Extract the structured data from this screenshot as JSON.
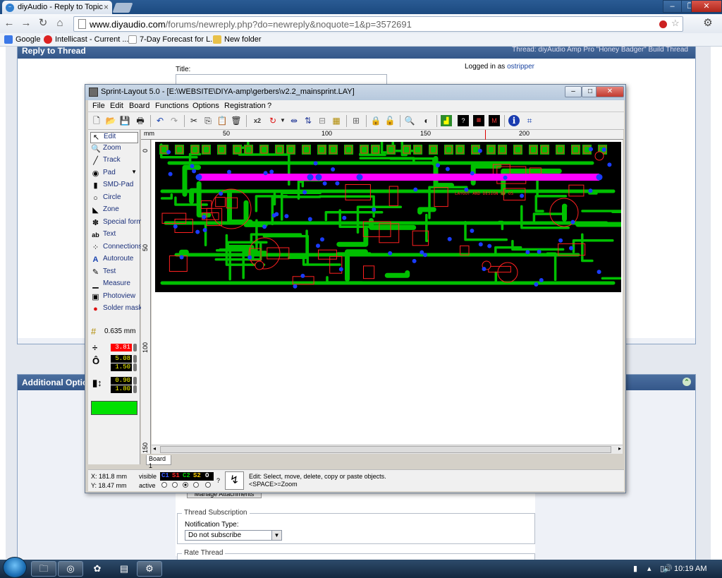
{
  "browser": {
    "tab_title": "diyAudio - Reply to Topic",
    "url_host": "www.diyaudio.com",
    "url_path": "/forums/newreply.php?do=newreply&noquote=1&p=3572691",
    "bookmarks": [
      "Google",
      "Intellicast - Current ...",
      "7-Day Forecast for L...",
      "New folder"
    ]
  },
  "forum": {
    "reply_header": "Reply to Thread",
    "thread_ref": "Thread: diyAudio Amp Pro \"Honey Badger\" Build Thread",
    "title_label": "Title:",
    "logged_in_label": "Logged in as",
    "username": "ostripper",
    "additional_options_header": "Additional Options",
    "manage_attachments_label": "Manage Attachments",
    "thread_subscription_legend": "Thread Subscription",
    "notification_type_label": "Notification Type:",
    "notification_value": "Do not subscribe",
    "rate_thread_legend": "Rate Thread"
  },
  "sprint": {
    "window_title": "Sprint-Layout 5.0 - [E:\\WEBSITE\\DIYA-amp\\gerbers\\v2.2_mainsprint.LAY]",
    "menu": [
      "File",
      "Edit",
      "Board",
      "Functions",
      "Options",
      "Registration",
      "?"
    ],
    "toolbar_x2": "x2",
    "tools": [
      "Edit",
      "Zoom",
      "Track",
      "Pad",
      "SMD-Pad",
      "Circle",
      "Zone",
      "Special form",
      "Text",
      "Connections",
      "Autoroute",
      "Test",
      "Measure",
      "Photoview",
      "Solder mask"
    ],
    "grid_value": "0.635 mm",
    "track_width": "3.81",
    "pad_outer": "5.08",
    "pad_inner": "1.50",
    "smd_w": "0.90",
    "smd_h": "1.80",
    "ruler_unit": "mm",
    "ruler_top": [
      "50",
      "100",
      "150",
      "200"
    ],
    "ruler_left": [
      "0",
      "50",
      "100",
      "150"
    ],
    "board_tab": "Board 1",
    "coord_x": "X:  181.8 mm",
    "coord_y": "Y:  18.47 mm",
    "visible_label": "visible",
    "active_label": "active",
    "layers": [
      "C1",
      "S1",
      "C2",
      "S2",
      "O"
    ],
    "layer_colors": [
      "#3a5cff",
      "#ff2a2a",
      "#00d000",
      "#ffd000",
      "#ffffff"
    ],
    "question": "?",
    "status_line1": "Edit: Select, move, delete, copy or paste objects.",
    "status_line2": "<SPACE>=Zoom",
    "pcb_silk_text": "LAYOUT AND DESIGN BY OS"
  },
  "taskbar": {
    "clock": "10:19 AM"
  },
  "colors": {
    "pcb_copper": "#00c000",
    "pcb_background": "#000000",
    "pcb_bus": "#ff00ff",
    "pcb_pad": "#1a3cff",
    "pcb_silk": "#ff2020"
  }
}
